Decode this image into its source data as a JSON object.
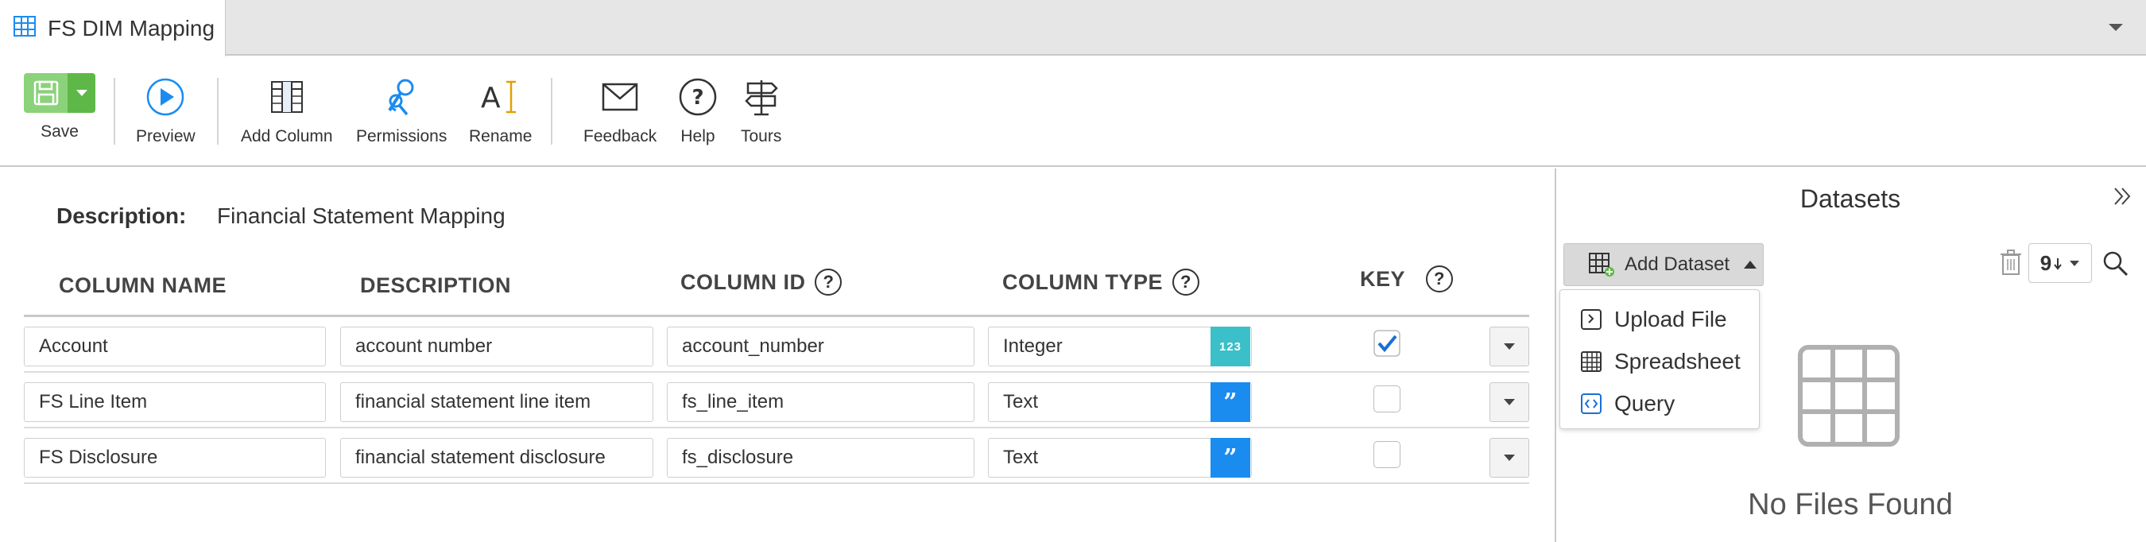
{
  "tab": {
    "title": "FS DIM Mapping"
  },
  "toolbar": {
    "save": "Save",
    "preview": "Preview",
    "add_column": "Add Column",
    "permissions": "Permissions",
    "rename": "Rename",
    "feedback": "Feedback",
    "help": "Help",
    "tours": "Tours"
  },
  "editor": {
    "description_label": "Description:",
    "description_value": "Financial Statement Mapping",
    "headers": {
      "column_name": "COLUMN NAME",
      "description": "DESCRIPTION",
      "column_id": "COLUMN ID",
      "column_type": "COLUMN TYPE",
      "key": "KEY"
    },
    "rows": [
      {
        "name": "Account",
        "description": "account number",
        "column_id": "account_number",
        "type": "Integer",
        "type_badge": "123",
        "key": true
      },
      {
        "name": "FS Line Item",
        "description": "financial statement line item",
        "column_id": "fs_line_item",
        "type": "Text",
        "type_badge": "”",
        "key": false
      },
      {
        "name": "FS Disclosure",
        "description": "financial statement disclosure",
        "column_id": "fs_disclosure",
        "type": "Text",
        "type_badge": "”",
        "key": false
      }
    ]
  },
  "panel": {
    "title": "Datasets",
    "add_dataset": "Add Dataset",
    "sort_label": "9",
    "menu": [
      "Upload File",
      "Spreadsheet",
      "Query"
    ],
    "empty": "No Files Found"
  },
  "colors": {
    "save_green": "#8bd27a",
    "save_green_dark": "#5eb847",
    "accent_blue": "#1a8cf0",
    "integer_teal": "#3bbfc8"
  }
}
